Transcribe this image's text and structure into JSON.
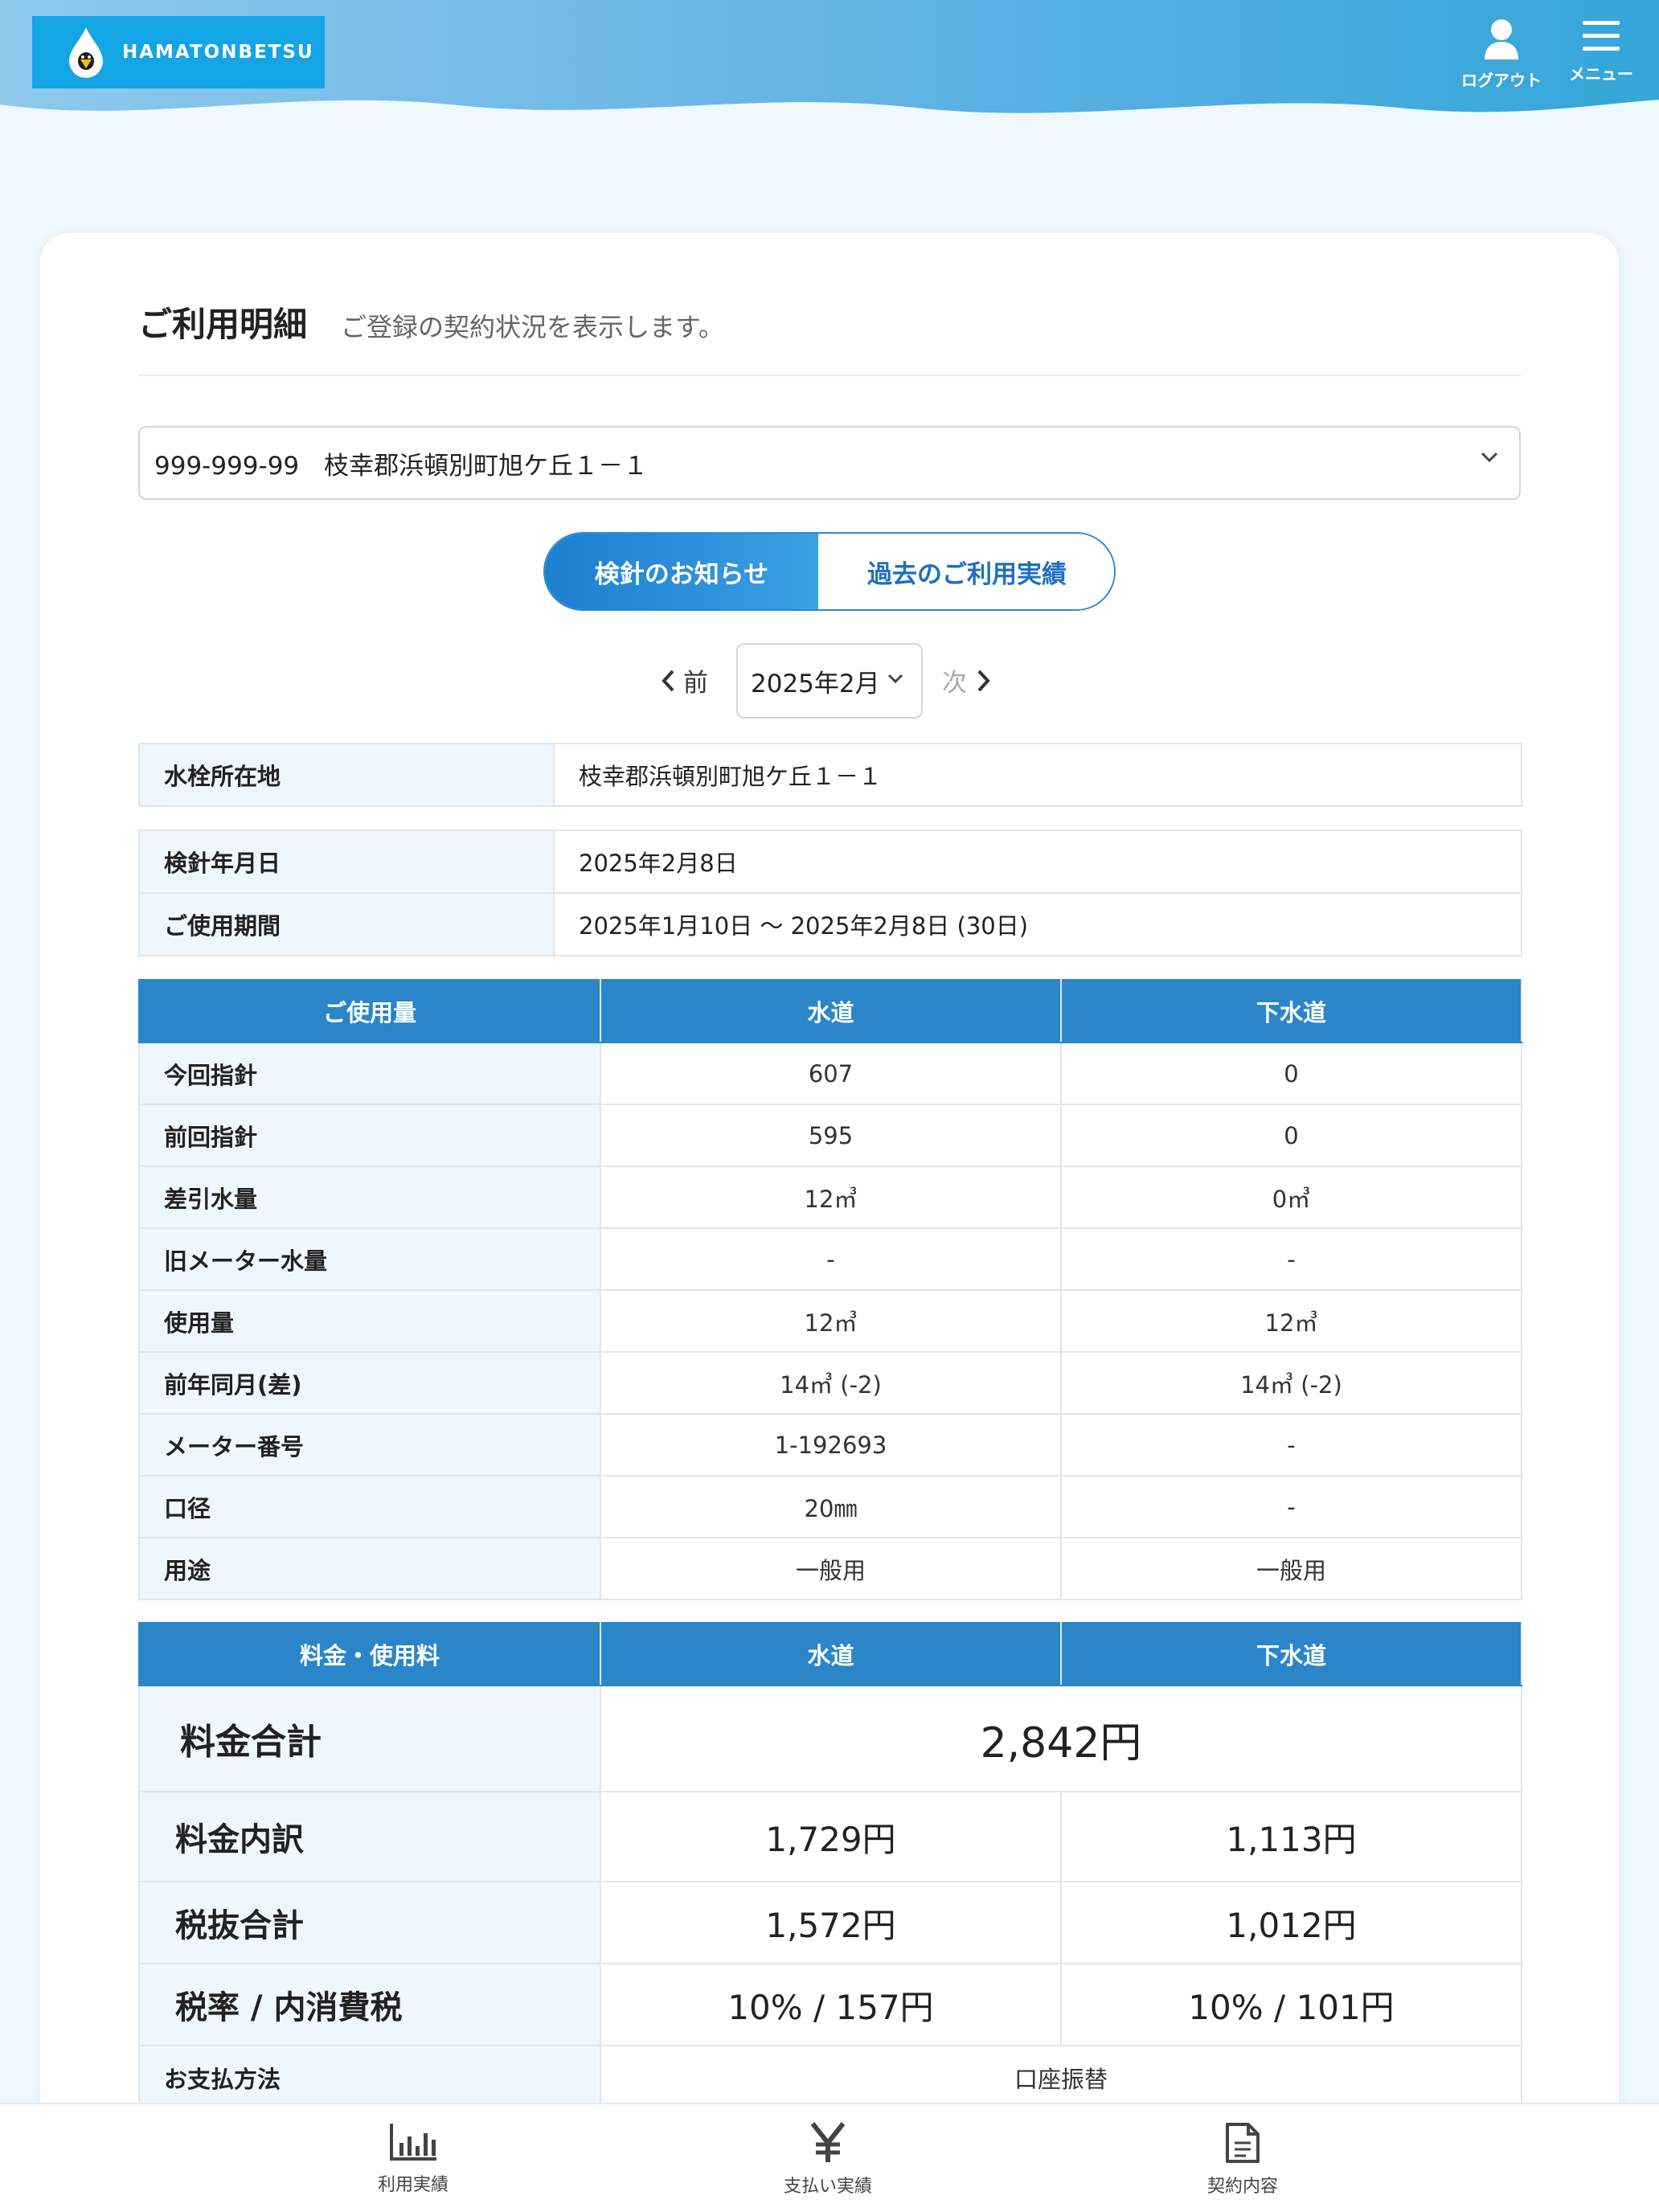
{
  "header": {
    "logo_text": "HAMATONBETSU",
    "logout_label": "ログアウト",
    "menu_label": "メニュー"
  },
  "page": {
    "title": "ご利用明細",
    "subtitle": "ご登録の契約状況を表示します。"
  },
  "address_select": {
    "value": "999-999-99　枝幸郡浜頓別町旭ケ丘１－１"
  },
  "tabs": [
    {
      "label": "検針のお知らせ",
      "active": true
    },
    {
      "label": "過去のご利用実績",
      "active": false
    }
  ],
  "month_nav": {
    "prev_label": "前",
    "selected_month": "2025年2月",
    "next_label": "次"
  },
  "location_table": {
    "label": "水栓所在地",
    "value": "枝幸郡浜頓別町旭ケ丘１－１"
  },
  "reading_table": [
    {
      "label": "検針年月日",
      "value": "2025年2月8日"
    },
    {
      "label": "ご使用期間",
      "value": "2025年1月10日 ～ 2025年2月8日 (30日)"
    }
  ],
  "usage_table": {
    "headers": [
      "ご使用量",
      "水道",
      "下水道"
    ],
    "rows": [
      {
        "label": "今回指針",
        "water": "607",
        "sewer": "0"
      },
      {
        "label": "前回指針",
        "water": "595",
        "sewer": "0"
      },
      {
        "label": "差引水量",
        "water": "12㎥",
        "sewer": "0㎥"
      },
      {
        "label": "旧メーター水量",
        "water": "-",
        "sewer": "-"
      },
      {
        "label": "使用量",
        "water": "12㎥",
        "sewer": "12㎥"
      },
      {
        "label": "前年同月(差)",
        "water": "14㎥ (-2)",
        "sewer": "14㎥ (-2)"
      },
      {
        "label": "メーター番号",
        "water": "1-192693",
        "sewer": "-"
      },
      {
        "label": "口径",
        "water": "20㎜",
        "sewer": "-"
      },
      {
        "label": "用途",
        "water": "一般用",
        "sewer": "一般用"
      }
    ]
  },
  "fee_table": {
    "headers": [
      "料金・使用料",
      "水道",
      "下水道"
    ],
    "total": {
      "label": "料金合計",
      "value": "2,842円"
    },
    "breakdown": {
      "label": "料金内訳",
      "water": "1,729円",
      "sewer": "1,113円"
    },
    "pretax": {
      "label": "税抜合計",
      "water": "1,572円",
      "sewer": "1,012円"
    },
    "tax": {
      "label": "税率 / 内消費税",
      "water": "10% / 157円",
      "sewer": "10% / 101円"
    },
    "payment": {
      "label": "お支払方法",
      "value": "口座振替"
    }
  },
  "bottom_nav": [
    {
      "label": "利用実績",
      "icon": "bar-chart-icon"
    },
    {
      "label": "支払い実績",
      "icon": "yen-icon"
    },
    {
      "label": "契約内容",
      "icon": "document-icon"
    }
  ],
  "colors": {
    "primary": "#2a86c9",
    "label_bg": "#eef7fd",
    "page_bg": "#eef8fd",
    "logo_bg": "#13a5e6"
  }
}
